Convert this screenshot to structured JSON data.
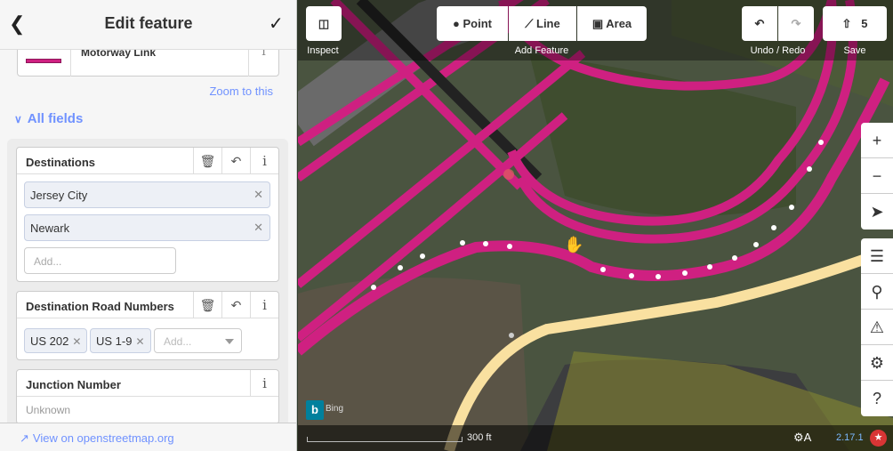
{
  "sidebar": {
    "header": {
      "title": "Edit feature",
      "back_icon": "chevron-left-icon",
      "done_icon": "checkmark-icon"
    },
    "preset": {
      "name": "Motorway Link",
      "info": "i"
    },
    "zoom_link": "Zoom to this",
    "all_fields": "All fields",
    "fields": {
      "destinations": {
        "label": "Destinations",
        "values": [
          "Jersey City",
          "Newark"
        ],
        "add_placeholder": "Add..."
      },
      "destination_road_numbers": {
        "label": "Destination Road Numbers",
        "values": [
          "US 202",
          "US 1-9"
        ],
        "add_placeholder": "Add..."
      },
      "junction_number": {
        "label": "Junction Number",
        "placeholder": "Unknown"
      }
    },
    "footer": {
      "osm_link": "View on openstreetmap.org"
    }
  },
  "toolbar": {
    "inspect_label": "Inspect",
    "point": "Point",
    "line": "Line",
    "area": "Area",
    "add_feature_label": "Add Feature",
    "undo_redo_label": "Undo / Redo",
    "save_count": "5",
    "save_label": "Save"
  },
  "map_controls": [
    "zoom-in-icon",
    "zoom-out-icon",
    "geolocate-icon",
    "layers-icon",
    "map-data-icon",
    "issues-icon",
    "preferences-icon",
    "help-icon"
  ],
  "footer": {
    "scale": "300 ft",
    "version": "2.17.1",
    "attribution": "Bing"
  },
  "colors": {
    "motorway": "#cf2081",
    "primary": "#f9e0a0",
    "accent": "#7092ff"
  }
}
